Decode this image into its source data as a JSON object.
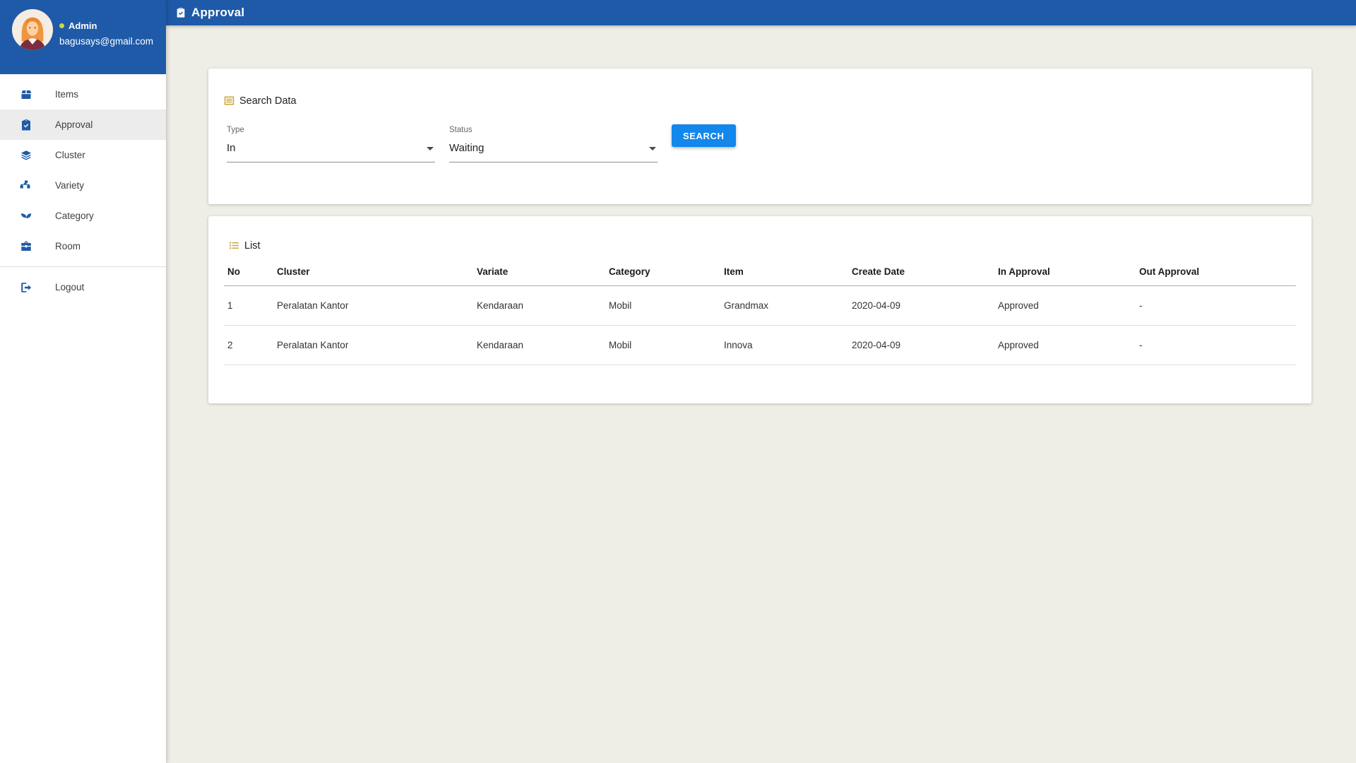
{
  "colors": {
    "primary_blue": "#1E5AA8",
    "search_button_blue": "#1287EC",
    "approved_green": "#28A745",
    "gold_icon": "#C9A842",
    "status_dot_yellow": "#CDDC39",
    "page_background": "#EFEEE6"
  },
  "header": {
    "title": "Approval"
  },
  "user": {
    "name": "Admin",
    "email": "bagusays@gmail.com"
  },
  "sidebar": {
    "items": [
      {
        "label": "Items"
      },
      {
        "label": "Approval",
        "active": true
      },
      {
        "label": "Cluster"
      },
      {
        "label": "Variety"
      },
      {
        "label": "Category"
      },
      {
        "label": "Room"
      }
    ],
    "logout_label": "Logout"
  },
  "search_card": {
    "title": "Search Data",
    "type_label": "Type",
    "type_value": "In",
    "status_label": "Status",
    "status_value": "Waiting",
    "search_button_label": "SEARCH"
  },
  "list_card": {
    "title": "List",
    "columns": [
      "No",
      "Cluster",
      "Variate",
      "Category",
      "Item",
      "Create Date",
      "In Approval",
      "Out Approval"
    ],
    "rows": [
      {
        "no": "1",
        "cluster": "Peralatan Kantor",
        "variate": "Kendaraan",
        "category": "Mobil",
        "item": "Grandmax",
        "create_date": "2020-04-09",
        "in_approval": "Approved",
        "out_approval": "-"
      },
      {
        "no": "2",
        "cluster": "Peralatan Kantor",
        "variate": "Kendaraan",
        "category": "Mobil",
        "item": "Innova",
        "create_date": "2020-04-09",
        "in_approval": "Approved",
        "out_approval": "-"
      }
    ]
  }
}
